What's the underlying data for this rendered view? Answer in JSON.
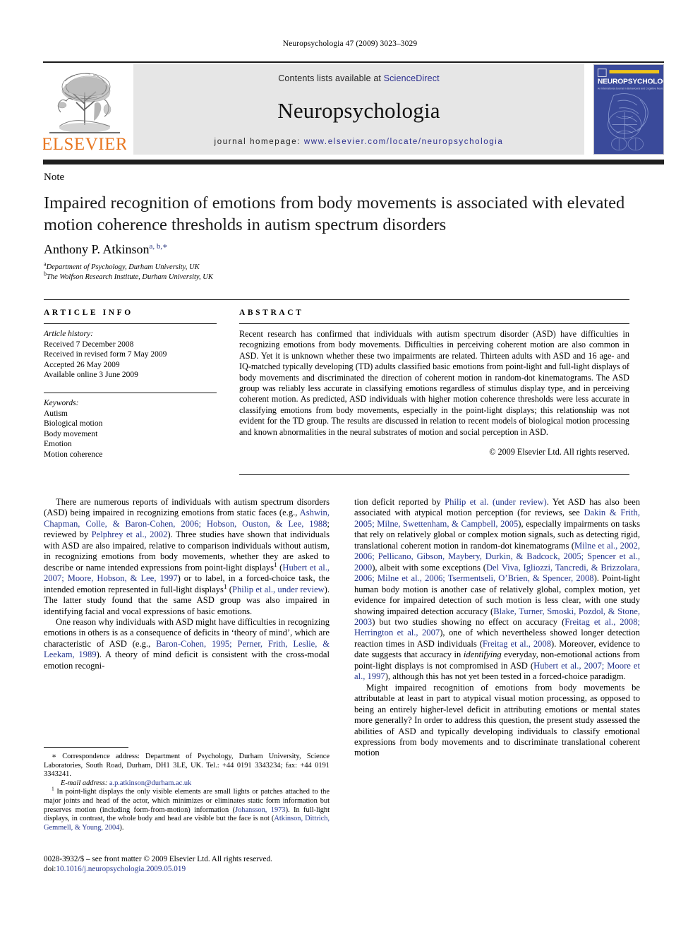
{
  "running_head": "Neuropsychologia 47 (2009) 3023–3029",
  "masthead": {
    "contents_prefix": "Contents lists available at ",
    "sciencedirect": "ScienceDirect",
    "journal_name": "Neuropsychologia",
    "homepage_prefix": "journal homepage: ",
    "homepage_url": "www.elsevier.com/locate/neuropsychologia",
    "publisher_wordmark": "ELSEVIER",
    "publisher_color": "#E87722",
    "link_color": "#2b2e8f",
    "cover_title": "NEUROPSYCHOLOGIA",
    "cover_subtitle": "An International Journal in Behavioural and Cognitive Neuroscience",
    "cover_color": "#3a4a9a"
  },
  "article": {
    "type": "Note",
    "title": "Impaired recognition of emotions from body movements is associated with elevated motion coherence thresholds in autism spectrum disorders",
    "author": "Anthony P. Atkinson",
    "author_marks": "a, b,∗",
    "affiliations": [
      {
        "mark": "a",
        "text": "Department of Psychology, Durham University, UK"
      },
      {
        "mark": "b",
        "text": "The Wolfson Research Institute, Durham University, UK"
      }
    ]
  },
  "article_info": {
    "heading": "ARTICLE INFO",
    "history_label": "Article history:",
    "history": [
      "Received 7 December 2008",
      "Received in revised form 7 May 2009",
      "Accepted 26 May 2009",
      "Available online 3 June 2009"
    ],
    "keywords_label": "Keywords:",
    "keywords": [
      "Autism",
      "Biological motion",
      "Body movement",
      "Emotion",
      "Motion coherence"
    ]
  },
  "abstract": {
    "heading": "ABSTRACT",
    "text": "Recent research has confirmed that individuals with autism spectrum disorder (ASD) have difficulties in recognizing emotions from body movements. Difficulties in perceiving coherent motion are also common in ASD. Yet it is unknown whether these two impairments are related. Thirteen adults with ASD and 16 age- and IQ-matched typically developing (TD) adults classified basic emotions from point-light and full-light displays of body movements and discriminated the direction of coherent motion in random-dot kinematograms. The ASD group was reliably less accurate in classifying emotions regardless of stimulus display type, and in perceiving coherent motion. As predicted, ASD individuals with higher motion coherence thresholds were less accurate in classifying emotions from body movements, especially in the point-light displays; this relationship was not evident for the TD group. The results are discussed in relation to recent models of biological motion processing and known abnormalities in the neural substrates of motion and social perception in ASD.",
    "copyright": "© 2009 Elsevier Ltd. All rights reserved."
  },
  "body": {
    "left_paragraphs": [
      {
        "runs": [
          {
            "t": "There are numerous reports of individuals with autism spectrum disorders (ASD) being impaired in recognizing emotions from static faces (e.g., "
          },
          {
            "t": "Ashwin, Chapman, Colle, & Baron-Cohen, 2006; Hobson, Ouston, & Lee, 1988",
            "s": "ref"
          },
          {
            "t": "; reviewed by "
          },
          {
            "t": "Pelphrey et al., 2002",
            "s": "ref"
          },
          {
            "t": "). Three studies have shown that individuals with ASD are also impaired, relative to comparison individuals without autism, in recognizing emotions from body movements, whether they are asked to describe or name intended expressions from point-light displays"
          },
          {
            "t": "1",
            "s": "sup"
          },
          {
            "t": " ("
          },
          {
            "t": "Hubert et al., 2007; Moore, Hobson, & Lee, 1997",
            "s": "ref"
          },
          {
            "t": ") or to label, in a forced-choice task, the intended emotion represented in full-light displays"
          },
          {
            "t": "1",
            "s": "sup"
          },
          {
            "t": " ("
          },
          {
            "t": "Philip et al., under review",
            "s": "ref"
          },
          {
            "t": "). The latter study found that the same ASD group was also impaired in identifying facial and vocal expressions of basic emotions."
          }
        ]
      },
      {
        "runs": [
          {
            "t": "One reason why individuals with ASD might have difficulties in recognizing emotions in others is as a consequence of deficits in ‘theory of mind’, which are characteristic of ASD (e.g., "
          },
          {
            "t": "Baron-Cohen, 1995; Perner, Frith, Leslie, & Leekam, 1989",
            "s": "ref"
          },
          {
            "t": "). A theory of mind deficit is consistent with the cross-modal emotion recogni-"
          }
        ]
      }
    ],
    "right_paragraphs": [
      {
        "no_indent": true,
        "runs": [
          {
            "t": "tion deficit reported by "
          },
          {
            "t": "Philip et al. (under review)",
            "s": "ref"
          },
          {
            "t": ". Yet ASD has also been associated with atypical motion perception (for reviews, see "
          },
          {
            "t": "Dakin & Frith, 2005; Milne, Swettenham, & Campbell, 2005",
            "s": "ref"
          },
          {
            "t": "), especially impairments on tasks that rely on relatively global or complex motion signals, such as detecting rigid, translational coherent motion in random-dot kinematograms ("
          },
          {
            "t": "Milne et al., 2002, 2006; Pellicano, Gibson, Maybery, Durkin, & Badcock, 2005; Spencer et al., 2000",
            "s": "ref"
          },
          {
            "t": "), albeit with some exceptions ("
          },
          {
            "t": "Del Viva, Igliozzi, Tancredi, & Brizzolara, 2006; Milne et al., 2006; Tsermentseli, O’Brien, & Spencer, 2008",
            "s": "ref"
          },
          {
            "t": "). Point-light human body motion is another case of relatively global, complex motion, yet evidence for impaired detection of such motion is less clear, with one study showing impaired detection accuracy ("
          },
          {
            "t": "Blake, Turner, Smoski, Pozdol, & Stone, 2003",
            "s": "ref"
          },
          {
            "t": ") but two studies showing no effect on accuracy ("
          },
          {
            "t": "Freitag et al., 2008; Herrington et al., 2007",
            "s": "ref"
          },
          {
            "t": "), one of which nevertheless showed longer detection reaction times in ASD individuals ("
          },
          {
            "t": "Freitag et al., 2008",
            "s": "ref"
          },
          {
            "t": "). Moreover, evidence to date suggests that accuracy in "
          },
          {
            "t": "identifying",
            "s": "it"
          },
          {
            "t": " everyday, non-emotional actions from point-light displays is not compromised in ASD ("
          },
          {
            "t": "Hubert et al., 2007; Moore et al., 1997",
            "s": "ref"
          },
          {
            "t": "), although this has not yet been tested in a forced-choice paradigm."
          }
        ]
      },
      {
        "runs": [
          {
            "t": "Might impaired recognition of emotions from body movements be attributable at least in part to atypical visual motion processing, as opposed to being an entirely higher-level deficit in attributing emotions or mental states more generally? In order to address this question, the present study assessed the abilities of ASD and typically developing individuals to classify emotional expressions from body movements and to discriminate translational coherent motion"
          }
        ]
      }
    ]
  },
  "footnotes": {
    "correspondence": "∗ Correspondence address: Department of Psychology, Durham University, Science Laboratories, South Road, Durham, DH1 3LE, UK. Tel.: +44 0191 3343234; fax: +44 0191 3343241.",
    "email_label": "E-mail address:",
    "email": "a.p.atkinson@durham.ac.uk",
    "note1_mark": "1",
    "note1_runs": [
      {
        "t": " In point-light displays the only visible elements are small lights or patches attached to the major joints and head of the actor, which minimizes or eliminates static form information but preserves motion (including form-from-motion) information ("
      },
      {
        "t": "Johansson, 1973",
        "s": "ref"
      },
      {
        "t": "). In full-light displays, in contrast, the whole body and head are visible but the face is not ("
      },
      {
        "t": "Atkinson, Dittrich, Gemmell, & Young, 2004",
        "s": "ref"
      },
      {
        "t": ")."
      }
    ]
  },
  "imprint": {
    "line1": "0028-3932/$ – see front matter © 2009 Elsevier Ltd. All rights reserved.",
    "doi_label": "doi:",
    "doi": "10.1016/j.neuropsychologia.2009.05.019"
  }
}
